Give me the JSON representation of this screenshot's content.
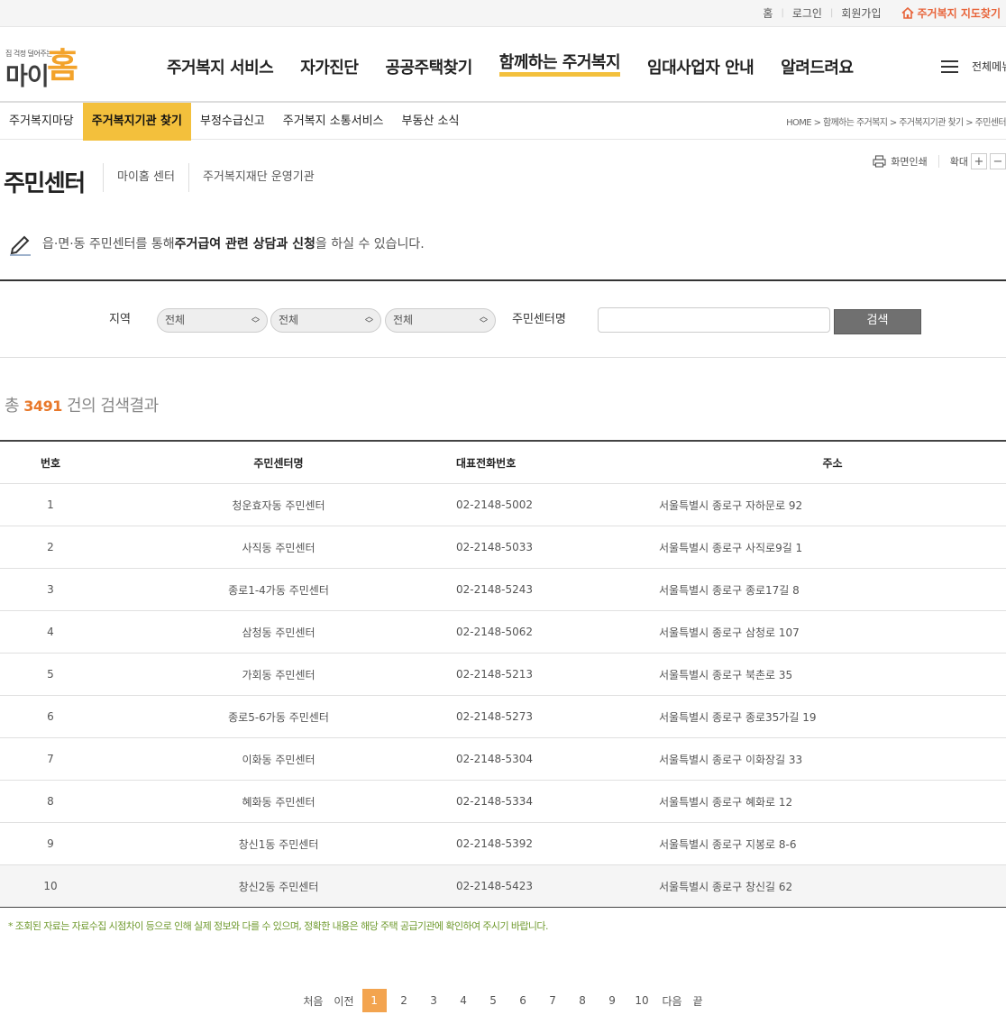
{
  "topbar": {
    "home": "홈",
    "login": "로그인",
    "signup": "회원가입",
    "map_link": "주거복지 지도찾기"
  },
  "logo": {
    "slogan": "집 걱정 덜어주는",
    "mai": "마이",
    "home": "홈"
  },
  "gnb": [
    "주거복지 서비스",
    "자가진단",
    "공공주택찾기",
    "함께하는 주거복지",
    "임대사업자 안내",
    "알려드려요"
  ],
  "gnb_active": "함께하는 주거복지",
  "all_menu": "전체메뉴",
  "subnav": {
    "tabs": [
      "주거복지마당",
      "주거복지기관 찾기",
      "부정수급신고",
      "주거복지 소통서비스",
      "부동산 소식"
    ],
    "breadcrumb": "HOME > 함께하는 주거복지 > 주거복지기관 찾기 > 주민센터"
  },
  "page": {
    "title": "주민센터",
    "title_tabs": [
      "마이홈 센터",
      "주거복지재단 운영기관"
    ],
    "print": "화면인쇄",
    "zoom": "확대",
    "zoom_in": "+",
    "zoom_out": "−",
    "notice_pre": "읍·면·동 주민센터를 통해 ",
    "notice_bold": "주거급여 관련 상담과 신청",
    "notice_post": "을 하실 수 있습니다."
  },
  "search": {
    "region_label": "지역",
    "selects": [
      "전체",
      "전체",
      "전체"
    ],
    "name_label": "주민센터명",
    "name_value": "",
    "button": "검색"
  },
  "result": {
    "prefix": "총 ",
    "count": "3491",
    "suffix": " 건의 검색결과"
  },
  "table": {
    "headers": [
      "번호",
      "주민센터명",
      "대표전화번호",
      "주소"
    ],
    "rows": [
      [
        "1",
        "청운효자동 주민센터",
        "02-2148-5002",
        "서울특별시 종로구 자하문로 92"
      ],
      [
        "2",
        "사직동 주민센터",
        "02-2148-5033",
        "서울특별시 종로구 사직로9길 1"
      ],
      [
        "3",
        "종로1-4가동 주민센터",
        "02-2148-5243",
        "서울특별시 종로구 종로17길 8"
      ],
      [
        "4",
        "삼청동 주민센터",
        "02-2148-5062",
        "서울특별시 종로구 삼청로 107"
      ],
      [
        "5",
        "가회동 주민센터",
        "02-2148-5213",
        "서울특별시 종로구 북촌로 35"
      ],
      [
        "6",
        "종로5-6가동 주민센터",
        "02-2148-5273",
        "서울특별시 종로구 종로35가길 19"
      ],
      [
        "7",
        "이화동 주민센터",
        "02-2148-5304",
        "서울특별시 종로구 이화장길 33"
      ],
      [
        "8",
        "혜화동 주민센터",
        "02-2148-5334",
        "서울특별시 종로구 혜화로 12"
      ],
      [
        "9",
        "창신1동 주민센터",
        "02-2148-5392",
        "서울특별시 종로구 지봉로 8-6"
      ],
      [
        "10",
        "창신2동 주민센터",
        "02-2148-5423",
        "서울특별시 종로구 창신길 62"
      ]
    ]
  },
  "footnote": "* 조회된 자료는 자료수집 시점차이 등으로 인해 실제 정보와 다를 수 있으며, 정확한 내용은 해당 주택 공급기관에 확인하여 주시기 바랍니다.",
  "pager": {
    "first": "처음",
    "prev": "이전",
    "pages": [
      "1",
      "2",
      "3",
      "4",
      "5",
      "6",
      "7",
      "8",
      "9",
      "10"
    ],
    "current": "1",
    "next": "다음",
    "last": "끝"
  },
  "colors": {
    "accent": "#f3c03c",
    "logo_orange": "#f3a32b",
    "map_link": "#e8643a",
    "count": "#e8782a",
    "footnote": "#6f9a2e",
    "search_button": "#707070"
  }
}
